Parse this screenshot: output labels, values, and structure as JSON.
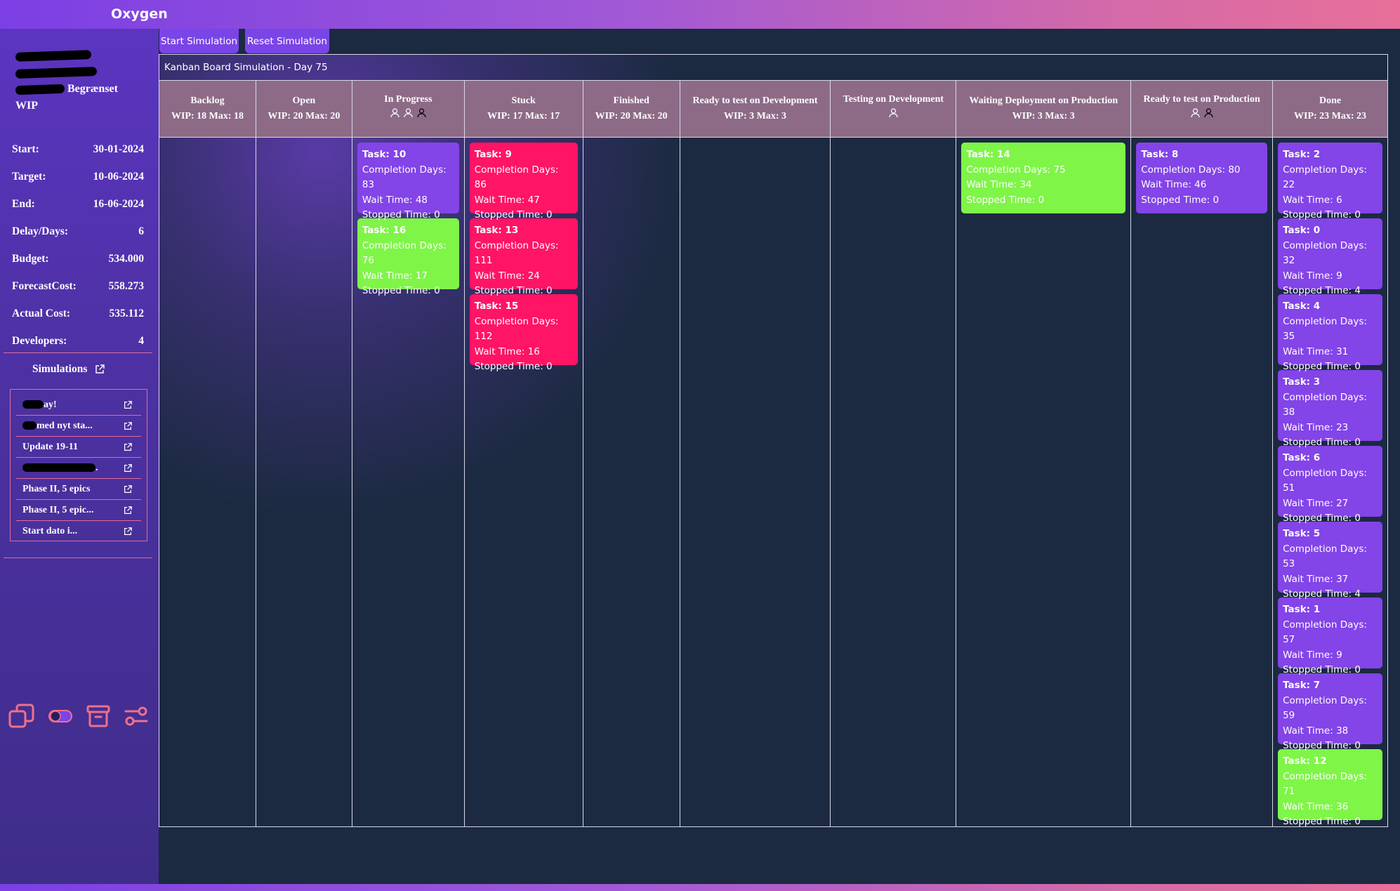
{
  "app": {
    "brand": "Oxygen"
  },
  "sidebar": {
    "project_lines": [
      "",
      "",
      "Begrænset",
      "WIP"
    ],
    "stats": [
      {
        "label": "Start:",
        "value": "30-01-2024"
      },
      {
        "label": "Target:",
        "value": "10-06-2024"
      },
      {
        "label": "End:",
        "value": "16-06-2024"
      },
      {
        "label": "Delay/Days:",
        "value": "6"
      },
      {
        "label": "Budget:",
        "value": "534.000"
      },
      {
        "label": "ForecastCost:",
        "value": "558.273"
      },
      {
        "label": "Actual Cost:",
        "value": "535.112"
      },
      {
        "label": "Developers:",
        "value": "4"
      }
    ],
    "simulations_title": "Simulations",
    "simulations": [
      {
        "label": "ay!"
      },
      {
        "label": "med nyt sta..."
      },
      {
        "label": "Update 19-11"
      },
      {
        "label": "."
      },
      {
        "label": "Phase II, 5 epics"
      },
      {
        "label": "Phase II, 5 epic..."
      },
      {
        "label": "Start dato i..."
      }
    ],
    "bottom_icons": [
      "copy-icon",
      "toggle-icon",
      "archive-icon",
      "settings-sliders-icon"
    ]
  },
  "toolbar": {
    "start_label": "Start Simulation",
    "reset_label": "Reset Simulation"
  },
  "board": {
    "title": "Kanban Board Simulation - Day 75",
    "columns": [
      {
        "name": "Backlog",
        "sub": "WIP: 18 Max: 18",
        "devs": 0,
        "cards": []
      },
      {
        "name": "Open",
        "sub": "WIP: 20 Max: 20",
        "devs": 0,
        "cards": []
      },
      {
        "name": "In Progress",
        "sub": "",
        "devs": 3,
        "cards": [
          {
            "task": "Task: 10",
            "completion": "Completion Days: 83",
            "wait": "Wait Time: 48",
            "stopped": "Stopped Time: 0",
            "color": "purple"
          },
          {
            "task": "Task: 16",
            "completion": "Completion Days: 76",
            "wait": "Wait Time: 17",
            "stopped": "Stopped Time: 0",
            "color": "green"
          }
        ]
      },
      {
        "name": "Stuck",
        "sub": "WIP: 17 Max: 17",
        "devs": 0,
        "cards": [
          {
            "task": "Task: 9",
            "completion": "Completion Days: 86",
            "wait": "Wait Time: 47",
            "stopped": "Stopped Time: 0",
            "color": "red"
          },
          {
            "task": "Task: 13",
            "completion": "Completion Days: 111",
            "wait": "Wait Time: 24",
            "stopped": "Stopped Time: 0",
            "color": "red"
          },
          {
            "task": "Task: 15",
            "completion": "Completion Days: 112",
            "wait": "Wait Time: 16",
            "stopped": "Stopped Time: 0",
            "color": "red"
          }
        ]
      },
      {
        "name": "Finished",
        "sub": "WIP: 20 Max: 20",
        "devs": 0,
        "cards": []
      },
      {
        "name": "Ready to test on Development",
        "sub": "WIP: 3 Max: 3",
        "devs": 0,
        "cards": []
      },
      {
        "name": "Testing on Development",
        "sub": "",
        "devs": 1,
        "cards": []
      },
      {
        "name": "Waiting Deployment on Production",
        "sub": "WIP: 3 Max: 3",
        "devs": 0,
        "cards": [
          {
            "task": "Task: 14",
            "completion": "Completion Days: 75",
            "wait": "Wait Time: 34",
            "stopped": "Stopped Time: 0",
            "color": "green"
          }
        ]
      },
      {
        "name": "Ready to test on Production",
        "sub": "",
        "devs": 2,
        "cards": [
          {
            "task": "Task: 8",
            "completion": "Completion Days: 80",
            "wait": "Wait Time: 46",
            "stopped": "Stopped Time: 0",
            "color": "purple"
          }
        ]
      },
      {
        "name": "Done",
        "sub": "WIP: 23 Max: 23",
        "devs": 0,
        "cards": [
          {
            "task": "Task: 2",
            "completion": "Completion Days: 22",
            "wait": "Wait Time: 6",
            "stopped": "Stopped Time: 0",
            "color": "purple"
          },
          {
            "task": "Task: 0",
            "completion": "Completion Days: 32",
            "wait": "Wait Time: 9",
            "stopped": "Stopped Time: 4",
            "color": "purple"
          },
          {
            "task": "Task: 4",
            "completion": "Completion Days: 35",
            "wait": "Wait Time: 31",
            "stopped": "Stopped Time: 0",
            "color": "purple"
          },
          {
            "task": "Task: 3",
            "completion": "Completion Days: 38",
            "wait": "Wait Time: 23",
            "stopped": "Stopped Time: 0",
            "color": "purple"
          },
          {
            "task": "Task: 6",
            "completion": "Completion Days: 51",
            "wait": "Wait Time: 27",
            "stopped": "Stopped Time: 0",
            "color": "purple"
          },
          {
            "task": "Task: 5",
            "completion": "Completion Days: 53",
            "wait": "Wait Time: 37",
            "stopped": "Stopped Time: 4",
            "color": "purple"
          },
          {
            "task": "Task: 1",
            "completion": "Completion Days: 57",
            "wait": "Wait Time: 9",
            "stopped": "Stopped Time: 0",
            "color": "purple"
          },
          {
            "task": "Task: 7",
            "completion": "Completion Days: 59",
            "wait": "Wait Time: 38",
            "stopped": "Stopped Time: 0",
            "color": "purple"
          },
          {
            "task": "Task: 12",
            "completion": "Completion Days: 71",
            "wait": "Wait Time: 36",
            "stopped": "Stopped Time: 0",
            "color": "green"
          }
        ]
      }
    ]
  },
  "colors": {
    "card_purple": "#8344e8",
    "card_red": "#ff1466",
    "card_green": "#7ff548",
    "header_bg": "#8d6b87",
    "accent_pink": "#e06b9a"
  }
}
